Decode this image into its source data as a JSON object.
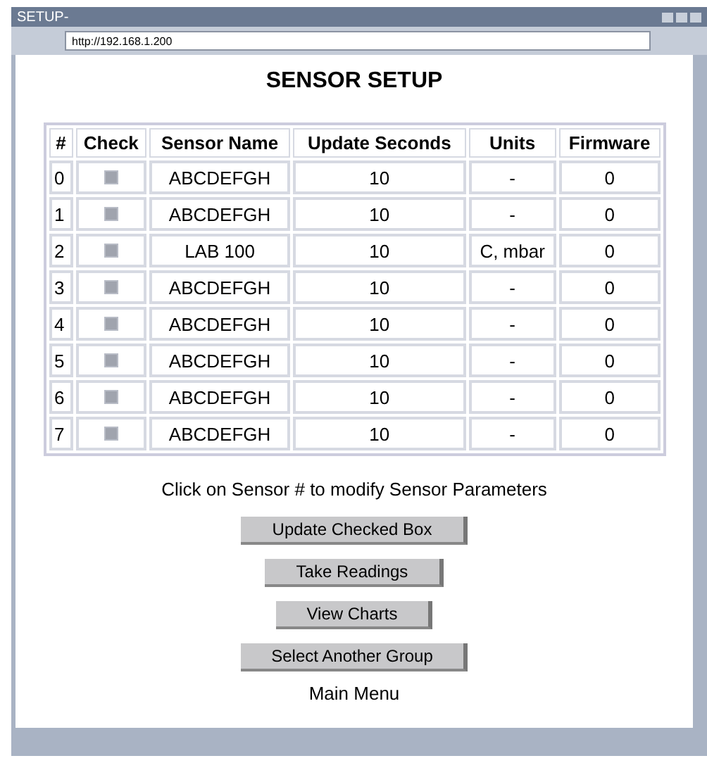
{
  "window": {
    "title": "SETUP-"
  },
  "address": "http://192.168.1.200",
  "heading": "SENSOR SETUP",
  "table": {
    "columns": [
      "#",
      "Check",
      "Sensor Name",
      "Update Seconds",
      "Units",
      "Firmware"
    ],
    "rows": [
      {
        "num": "0",
        "checked": true,
        "name": "ABCDEFGH",
        "seconds": "10",
        "units": "-",
        "firmware": "0"
      },
      {
        "num": "1",
        "checked": true,
        "name": "ABCDEFGH",
        "seconds": "10",
        "units": "-",
        "firmware": "0"
      },
      {
        "num": "2",
        "checked": true,
        "name": "LAB 100",
        "seconds": "10",
        "units": "C, mbar",
        "firmware": "0"
      },
      {
        "num": "3",
        "checked": true,
        "name": "ABCDEFGH",
        "seconds": "10",
        "units": "-",
        "firmware": "0"
      },
      {
        "num": "4",
        "checked": true,
        "name": "ABCDEFGH",
        "seconds": "10",
        "units": "-",
        "firmware": "0"
      },
      {
        "num": "5",
        "checked": true,
        "name": "ABCDEFGH",
        "seconds": "10",
        "units": "-",
        "firmware": "0"
      },
      {
        "num": "6",
        "checked": true,
        "name": "ABCDEFGH",
        "seconds": "10",
        "units": "-",
        "firmware": "0"
      },
      {
        "num": "7",
        "checked": true,
        "name": "ABCDEFGH",
        "seconds": "10",
        "units": "-",
        "firmware": "0"
      }
    ]
  },
  "hint": "Click on Sensor # to modify Sensor Parameters",
  "buttons": [
    "Update Checked Box",
    "Take Readings",
    "View Charts",
    "Select Another Group"
  ],
  "footer_link": "Main Menu"
}
